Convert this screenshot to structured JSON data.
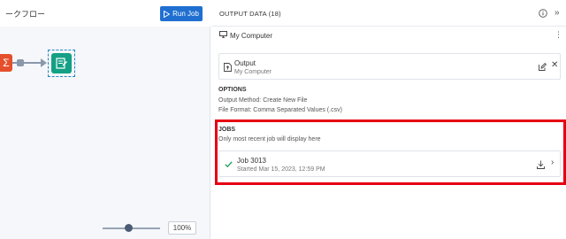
{
  "workflow": {
    "title": "ークフロー",
    "run_button": "Run Job",
    "sum_glyph": "Σ",
    "zoom_level": "100%",
    "zoom_fraction": 0.45
  },
  "panel": {
    "title": "OUTPUT DATA (18)",
    "location": "My Computer",
    "output": {
      "name": "Output",
      "subtitle": "My Computer"
    },
    "options": {
      "title": "OPTIONS",
      "method": "Output Method: Create New File",
      "format": "File Format: Comma Separated Values (.csv)"
    },
    "jobs": {
      "title": "JOBS",
      "subtitle": "Only most recent job will display here",
      "items": [
        {
          "name": "Job 3013",
          "started": "Started Mar 15, 2023, 12:59 PM",
          "status": "success"
        }
      ]
    }
  },
  "colors": {
    "accent": "#1f6fd1",
    "highlight": "#e60012",
    "output_tool": "#14a085",
    "summarize_tool": "#e5502c"
  }
}
